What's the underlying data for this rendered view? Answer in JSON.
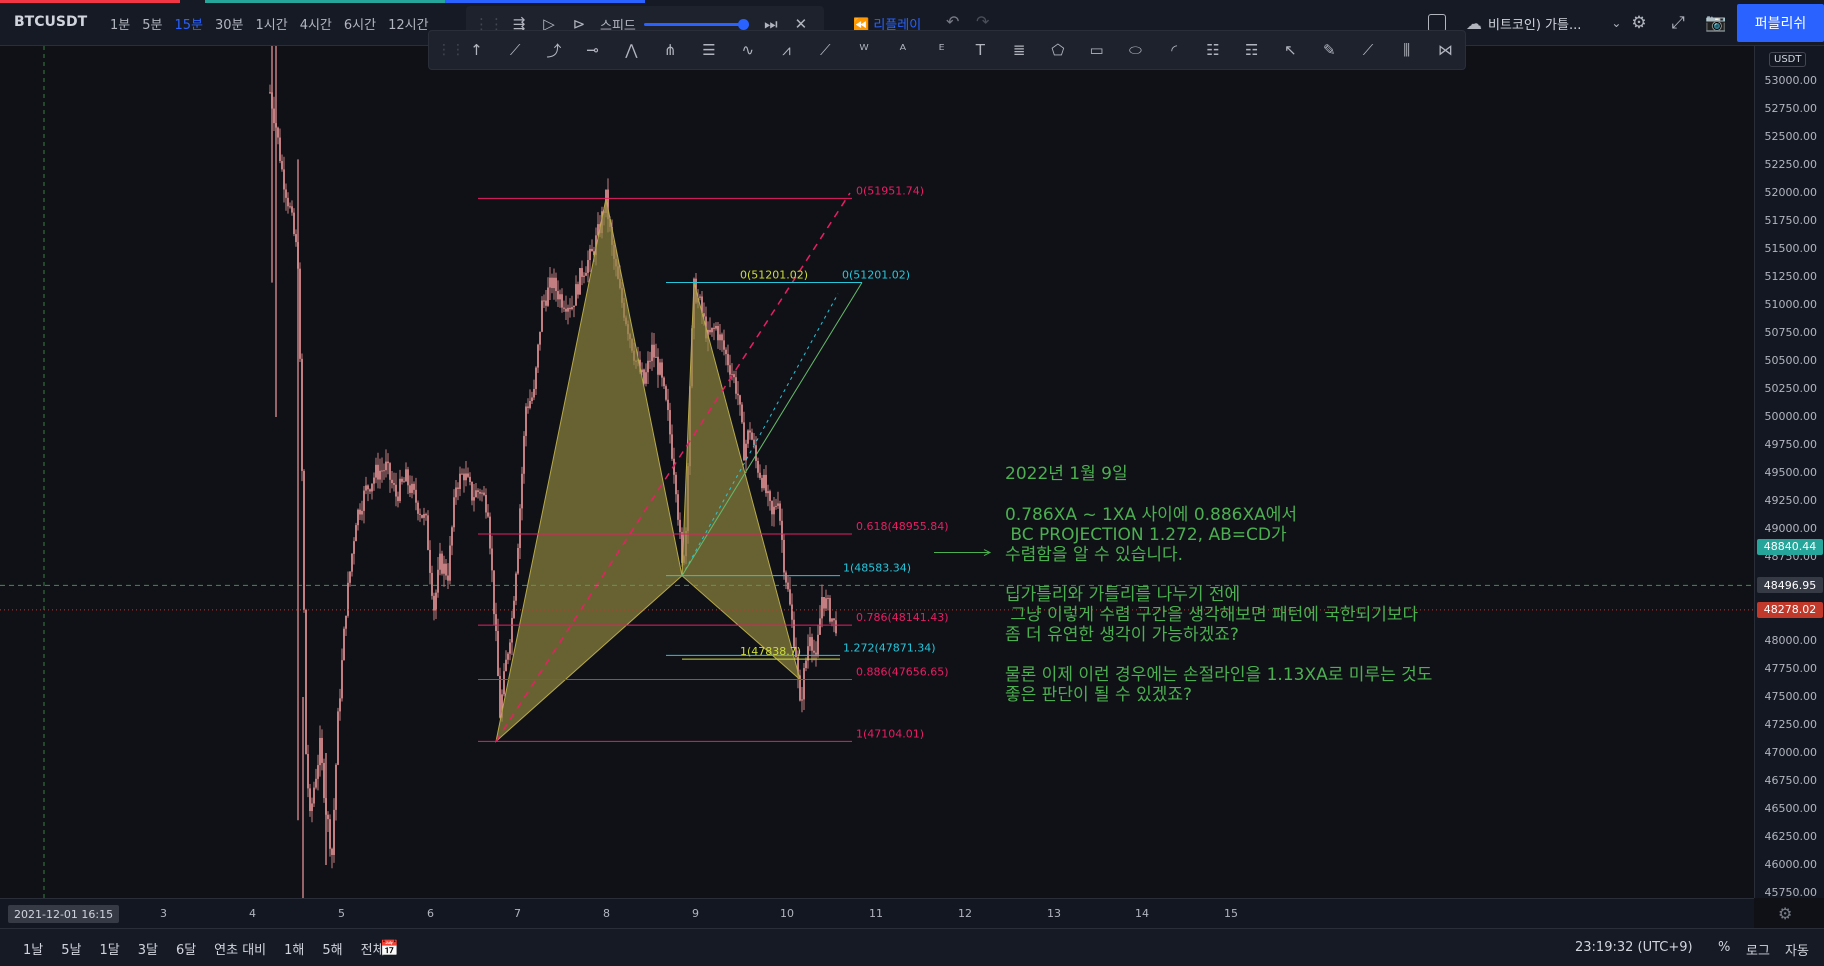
{
  "toolbar": {
    "symbol": "BTCUSDT",
    "intervals": [
      "1분",
      "5분",
      "15분",
      "30분",
      "1시간",
      "4시간",
      "6시간",
      "12시간"
    ],
    "active_interval": "15분",
    "speed_label": "스피드",
    "replay_label": "리플레이",
    "layout_name": "비트코인) 가틀...",
    "publish_label": "퍼블리쉬"
  },
  "drawing_tools": [
    "cursor-icon",
    "trend-line-icon",
    "ray-icon",
    "horizontal-line-icon",
    "path-icon",
    "pitchfork-icon",
    "parallel-channel-icon",
    "zigzag-icon",
    "polyline-icon",
    "arrow-line-icon",
    "xabcd-pattern-icon",
    "abcd-pattern-icon",
    "elliott-wave-icon",
    "text-icon",
    "fib-retracement-icon",
    "triangle-icon",
    "rectangle-icon",
    "ellipse-icon",
    "arc-icon",
    "long-position-icon",
    "short-position-icon",
    "select-icon",
    "brush-icon",
    "highlighter-icon",
    "volume-profile-icon",
    "harmonic-icon"
  ],
  "price_axis": {
    "currency": "USDT",
    "ticks": [
      "53000.00",
      "52750.00",
      "52500.00",
      "52250.00",
      "52000.00",
      "51750.00",
      "51500.00",
      "51250.00",
      "51000.00",
      "50750.00",
      "50500.00",
      "50250.00",
      "50000.00",
      "49750.00",
      "49500.00",
      "49250.00",
      "49000.00",
      "48750.00",
      "48500.00",
      "48250.00",
      "48000.00",
      "47750.00",
      "47500.00",
      "47250.00",
      "47000.00",
      "46750.00",
      "46500.00",
      "46250.00",
      "46000.00",
      "45750.00"
    ],
    "badges": [
      {
        "text": "48840.44",
        "color": "#26a69a",
        "price": 48840.44
      },
      {
        "text": "48496.95",
        "color": "#363a45",
        "price": 48496.95
      },
      {
        "text": "48278.02",
        "color": "#c0392b",
        "price": 48278.02
      }
    ]
  },
  "time_axis": {
    "cursor_date": "2021-12-01   16:15",
    "ticks": [
      "3",
      "4",
      "5",
      "6",
      "7",
      "8",
      "9",
      "10",
      "11",
      "12",
      "13",
      "14",
      "15"
    ]
  },
  "fib_labels": {
    "xa0": "0(51951.74)",
    "xa618": "0.618(48955.84)",
    "xa786": "0.786(48141.43)",
    "xa886": "0.886(47656.65)",
    "xa1": "1(47104.01)",
    "bc0_left": "0(51201.02)",
    "bc0_right": "0(51201.02)",
    "bc1": "1(48583.34)",
    "bc1272": "1.272(47871.34)",
    "bc_small": "1(47838.7)"
  },
  "annotation": {
    "lines": [
      "2022년 1월 9일",
      "",
      "0.786XA ~ 1XA 사이에 0.886XA에서",
      " BC PROJECTION 1.272, AB=CD가",
      "수렴함을 알 수 있습니다.",
      "",
      "딥가틀리와 가틀리를 나누기 전에",
      " 그냥 이렇게 수렴 구간을 생각해보면 패턴에 국한되기보다",
      "좀 더 유연한 생각이 가능하겠죠?",
      "",
      "물론 이제 이런 경우에는 손절라인을 1.13XA로 미루는 것도",
      "좋은 판단이 될 수 있겠죠?"
    ],
    "color": "#4caf50"
  },
  "bottom": {
    "ranges": [
      "1날",
      "5날",
      "1달",
      "3달",
      "6달",
      "연초 대비",
      "1해",
      "5해",
      "전체"
    ],
    "clock": "23:19:32 (UTC+9)",
    "percent": "%",
    "log": "로그",
    "auto": "자동"
  },
  "colors": {
    "candle": "#ef9a9a",
    "pattern_fill": "#8f8540",
    "fib_red": "#e91e63",
    "fib_teal": "#26c6da",
    "green_text": "#4caf50",
    "accent": "#2962ff"
  }
}
